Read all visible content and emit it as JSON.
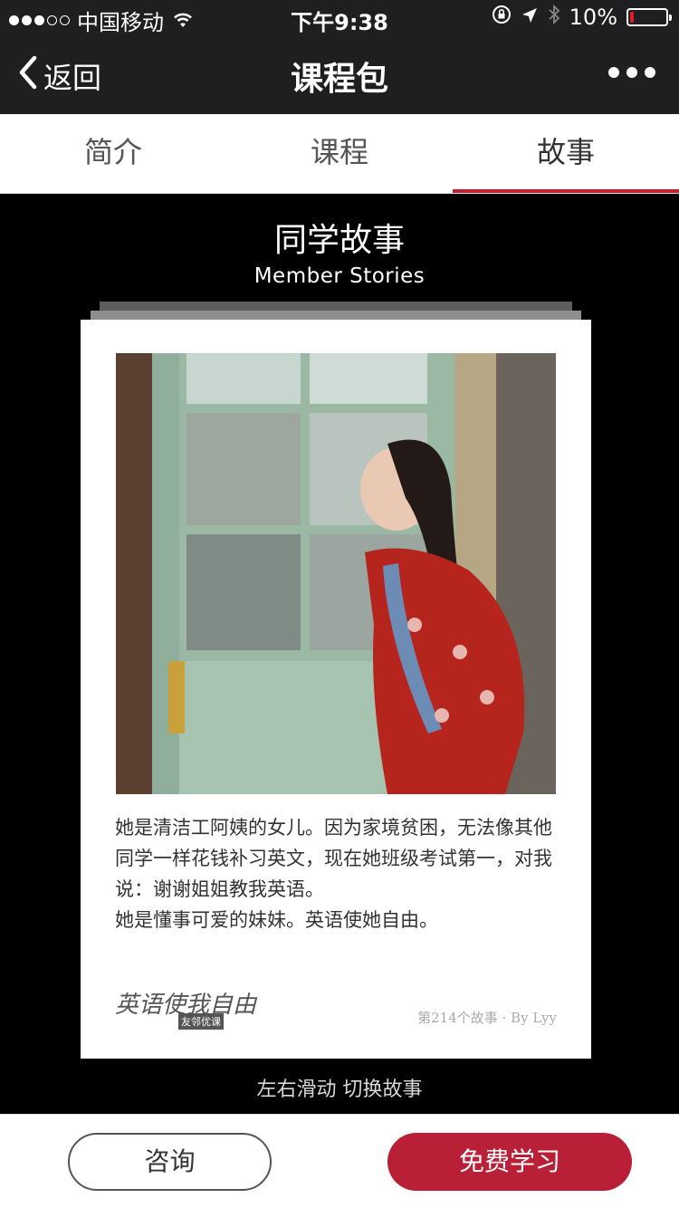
{
  "status_bar": {
    "carrier": "中国移动",
    "time": "下午9:38",
    "battery": "10%",
    "battery_level": 0.1
  },
  "nav": {
    "back_label": "返回",
    "title": "课程包"
  },
  "tabs": [
    {
      "label": "简介",
      "active": false
    },
    {
      "label": "课程",
      "active": false
    },
    {
      "label": "故事",
      "active": true
    }
  ],
  "section": {
    "title": "同学故事",
    "subtitle": "Member Stories"
  },
  "story": {
    "lines": [
      "她是清洁工阿姨的女儿。因为家境贫困，无法像其他同学一样花钱补习英文，现在她班级考试第一，对我说：谢谢姐姐教我英语。",
      "她是懂事可爱的妹妹。英语使她自由。"
    ],
    "logo_text": "英语使我自由",
    "logo_badge": "友邻优课",
    "credit": "第214个故事 · By Lyy"
  },
  "swipe_hint": "左右滑动 切换故事",
  "footer": {
    "consult_label": "咨询",
    "free_study_label": "免费学习"
  },
  "colors": {
    "accent": "#b91f36",
    "tab_underline": "#c81d30",
    "nav_bg": "#1f1f21",
    "battery_low": "#e01c24"
  },
  "icons": [
    "wifi-icon",
    "lock-rotation-icon",
    "location-arrow-icon",
    "bluetooth-icon",
    "battery-icon",
    "back-chevron-icon",
    "more-icon"
  ]
}
